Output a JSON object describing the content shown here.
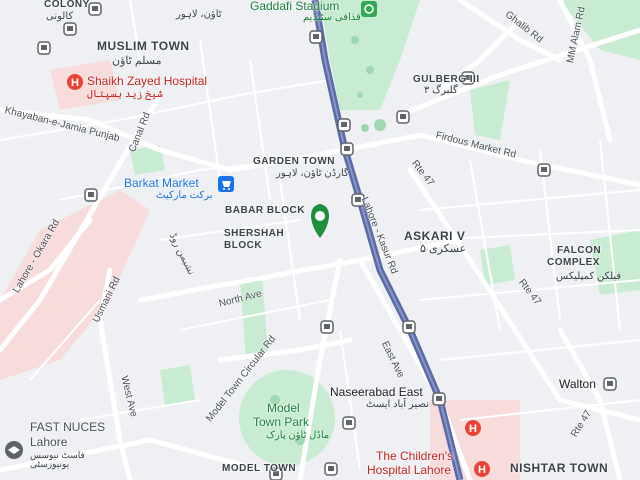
{
  "areas": {
    "muslim_town": "MUSLIM TOWN",
    "muslim_town_urdu": "مسلم ٹاؤن",
    "garden_town": "GARDEN TOWN",
    "garden_town_urdu": "گارڈن ٹاؤن، لاہور",
    "babar_block": "BABAR BLOCK",
    "shershah_block_1": "SHERSHAH",
    "shershah_block_2": "BLOCK",
    "gulberg_iii": "GULBERG III",
    "gulberg_iii_urdu": "گلبرگ ۳",
    "askari_v": "ASKARI V",
    "askari_v_urdu": "عسکری ۵",
    "falcon_1": "FALCON",
    "falcon_2": "COMPLEX",
    "falcon_urdu": "فیلکن کمپلیکس",
    "nishtar_town": "NISHTAR TOWN",
    "model_town": "MODEL TOWN",
    "colony": "COLONY",
    "colony_urdu": "کالونی",
    "top_urdu": "ٹاؤن، لاہور"
  },
  "pois": {
    "gaddafi": "Gaddafi Stadium",
    "gaddafi_urdu": "قذافی سٹیڈیم",
    "shaikh_zayed": "Shaikh Zayed Hospital",
    "shaikh_zayed_urdu": "شیخ زید ہسپتال",
    "barkat_market": "Barkat Market",
    "barkat_market_urdu": "برکت مارکیٹ",
    "model_town_park_1": "Model",
    "model_town_park_2": "Town Park",
    "model_town_park_urdu": "ماڈل ٹاؤن پارک",
    "naseerabad": "Naseerabad East",
    "naseerabad_urdu": "نصیر آباد ایسٹ",
    "childrens_hospital_1": "The Children's",
    "childrens_hospital_2": "Hospital Lahore",
    "fast_nuces_1": "FAST NUCES",
    "fast_nuces_2": "Lahore",
    "fast_nuces_urdu": "فاسٹ نیوسس یونیورسٹی",
    "walton": "Walton"
  },
  "roads": {
    "ghalib": "Ghalib Rd",
    "mm_alam": "MM Alam Rd",
    "khayaban": "Khayaban-e-Jamia Punjab",
    "canal": "Canal Rd",
    "firdous": "Firdous Market Rd",
    "rte47_a": "Rte 47",
    "rte47_b": "Rte 47",
    "rte47_c": "Rte 47",
    "lahore_kasur": "Lahore - Kasur Rd",
    "lahore_okara": "Lahore - Okara Rd",
    "usmani": "Usmani Rd",
    "nasheman": "نشیمن روڈ",
    "north_ave": "North Ave",
    "east_ave": "East Ave",
    "west_ave": "West Ave",
    "model_town_circular": "Model Town Circular Rd"
  },
  "colors": {
    "background": "#eef0f3",
    "park": "#c8ecd2",
    "hospital_area": "#f8dcdc",
    "metro_line": "#5b6ba8",
    "road": "#ffffff",
    "hospital_red": "#ea4335",
    "shopping_blue": "#1a73e8",
    "park_green": "#34a853",
    "transit_gray": "#5f6368"
  },
  "icons": {
    "hospital": "hospital-icon",
    "shopping": "shopping-cart-icon",
    "stadium": "stadium-icon",
    "park_pin": "park-pin-icon",
    "bus": "bus-stop-icon",
    "school": "school-icon"
  }
}
